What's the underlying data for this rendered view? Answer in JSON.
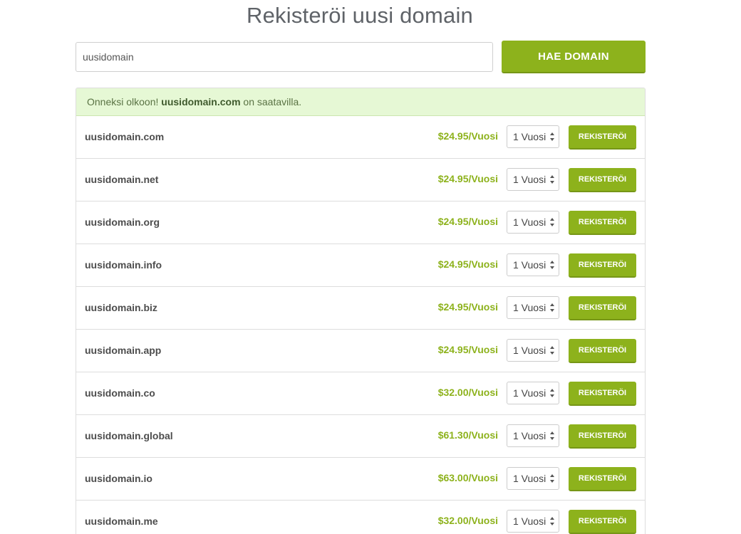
{
  "page": {
    "title": "Rekisteröi uusi domain"
  },
  "search": {
    "value": "uusidomain",
    "button_label": "HAE DOMAIN"
  },
  "alert": {
    "prefix": "Onneksi olkoon! ",
    "domain": "uusidomain.com",
    "suffix": " on saatavilla."
  },
  "colors": {
    "accent": "#8db21c",
    "alert_background": "#e6f8d5"
  },
  "results": [
    {
      "domain": "uusidomain.com",
      "price": "$24.95/Vuosi",
      "period": "1 Vuosi",
      "button": "REKISTERÖI"
    },
    {
      "domain": "uusidomain.net",
      "price": "$24.95/Vuosi",
      "period": "1 Vuosi",
      "button": "REKISTERÖI"
    },
    {
      "domain": "uusidomain.org",
      "price": "$24.95/Vuosi",
      "period": "1 Vuosi",
      "button": "REKISTERÖI"
    },
    {
      "domain": "uusidomain.info",
      "price": "$24.95/Vuosi",
      "period": "1 Vuosi",
      "button": "REKISTERÖI"
    },
    {
      "domain": "uusidomain.biz",
      "price": "$24.95/Vuosi",
      "period": "1 Vuosi",
      "button": "REKISTERÖI"
    },
    {
      "domain": "uusidomain.app",
      "price": "$24.95/Vuosi",
      "period": "1 Vuosi",
      "button": "REKISTERÖI"
    },
    {
      "domain": "uusidomain.co",
      "price": "$32.00/Vuosi",
      "period": "1 Vuosi",
      "button": "REKISTERÖI"
    },
    {
      "domain": "uusidomain.global",
      "price": "$61.30/Vuosi",
      "period": "1 Vuosi",
      "button": "REKISTERÖI"
    },
    {
      "domain": "uusidomain.io",
      "price": "$63.00/Vuosi",
      "period": "1 Vuosi",
      "button": "REKISTERÖI"
    },
    {
      "domain": "uusidomain.me",
      "price": "$32.00/Vuosi",
      "period": "1 Vuosi",
      "button": "REKISTERÖI"
    }
  ]
}
